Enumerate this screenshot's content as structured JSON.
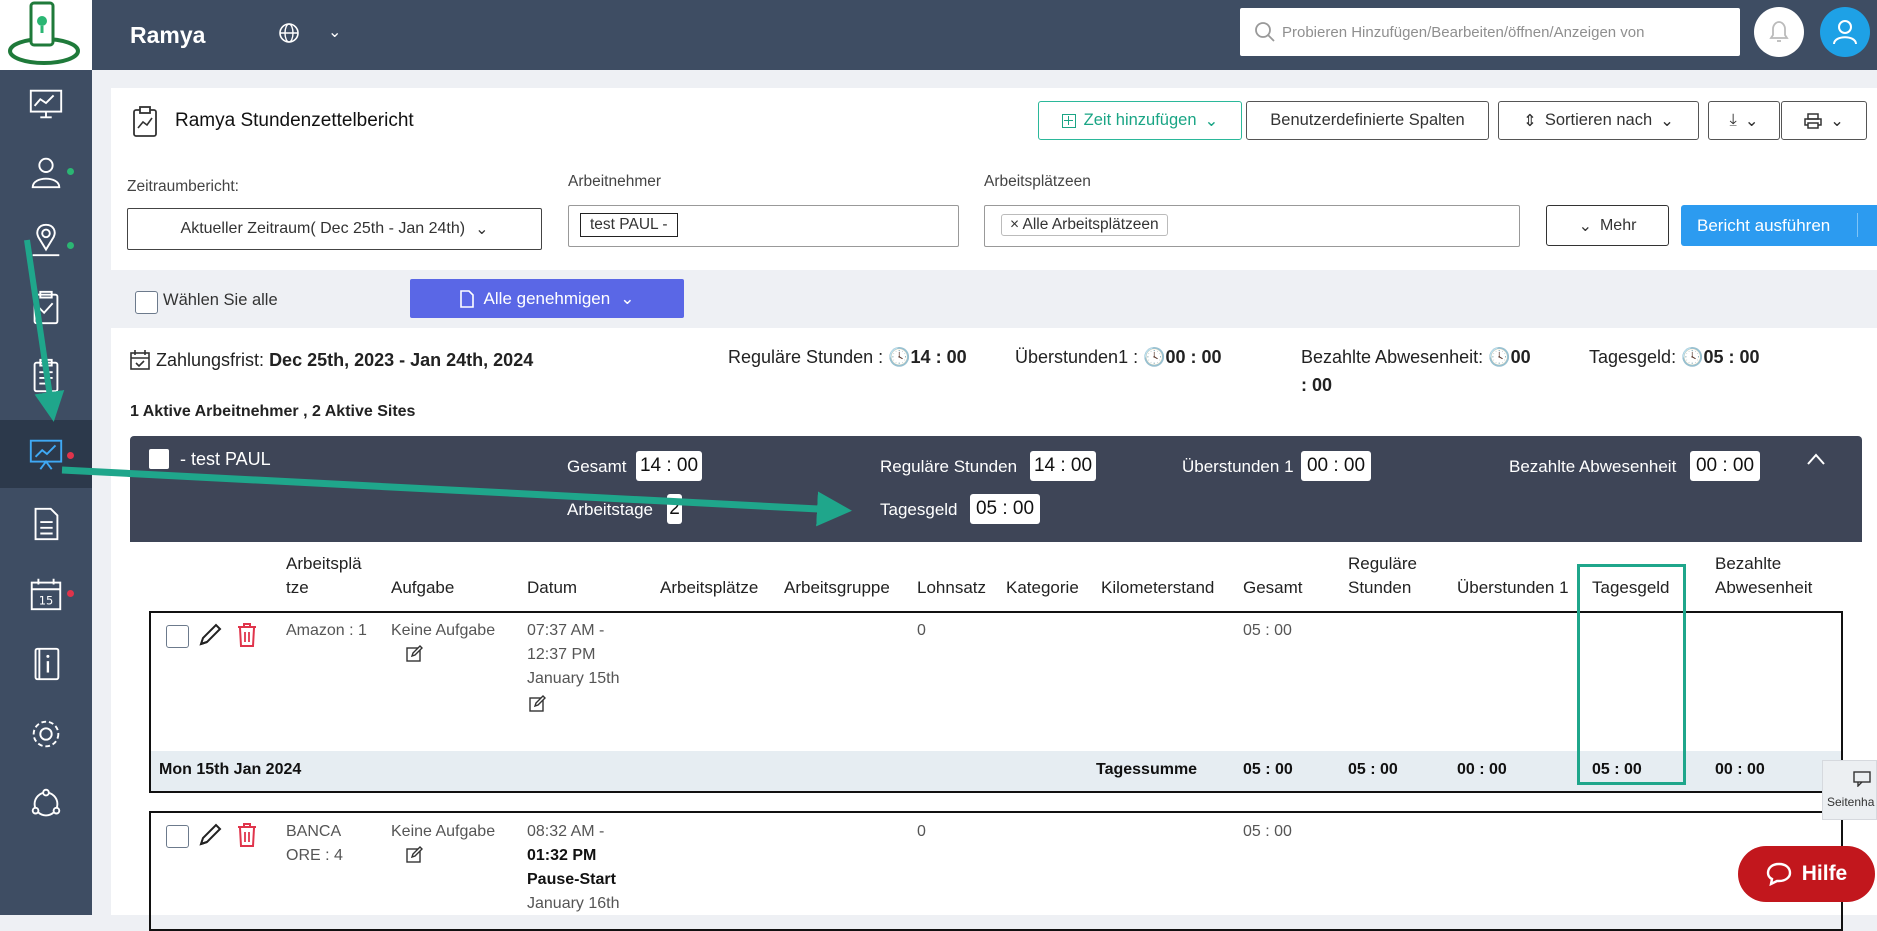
{
  "app": {
    "title": "Ramya"
  },
  "search": {
    "placeholder": "Probieren Hinzufügen/Bearbeiten/öffnen/Anzeigen von"
  },
  "header": {
    "title": "Ramya Stundenzettelbericht",
    "buttons": {
      "add_time": "Zeit hinzufügen",
      "custom_columns": "Benutzerdefinierte Spalten",
      "sort_by": "Sortieren nach"
    }
  },
  "filters": {
    "period_label": "Zeitraumbericht:",
    "period_value": "Aktueller Zeitraum( Dec 25th - Jan 24th)",
    "employee_label": "Arbeitnehmer",
    "employee_tag": "test PAUL -",
    "sites_label": "Arbeitsplätzeen",
    "sites_tag": "Alle Arbeitsplätzeen",
    "more": "Mehr",
    "run": "Bericht ausführen"
  },
  "actions": {
    "select_all": "Wählen Sie alle",
    "approve_all": "Alle genehmigen"
  },
  "summary": {
    "deadline_label": "Zahlungsfrist:",
    "deadline_value": "Dec 25th, 2023 - Jan 24th, 2024",
    "regular_label": "Reguläre Stunden :",
    "regular_value": "14 : 00",
    "overtime_label": "Überstunden1 :",
    "overtime_value": "00 : 00",
    "paid_absence_label": "Bezahlte Abwesenheit:",
    "paid_absence_value_1": "00",
    "paid_absence_value_2": ": 00",
    "per_diem_label": "Tagesgeld:",
    "per_diem_value": "05 : 00",
    "active": "1 Aktive Arbeitnehmer , 2 Aktive Sites"
  },
  "employee": {
    "name": "- test PAUL",
    "total_label": "Gesamt",
    "total_value": "14 : 00",
    "regular_label": "Reguläre Stunden",
    "regular_value": "14 : 00",
    "overtime_label": "Überstunden 1",
    "overtime_value": "00 : 00",
    "paid_absence_label": "Bezahlte Abwesenheit",
    "paid_absence_value": "00 : 00",
    "workdays_label": "Arbeitstage",
    "workdays_value": "2",
    "per_diem_label": "Tagesgeld",
    "per_diem_value": "05 : 00"
  },
  "columns": {
    "site_1": "Arbeitsplä",
    "site_2": "tze",
    "task": "Aufgabe",
    "date": "Datum",
    "sites": "Arbeitsplätze",
    "group": "Arbeitsgruppe",
    "wage": "Lohnsatz",
    "category": "Kategorie",
    "mileage": "Kilometerstand",
    "total": "Gesamt",
    "regular_1": "Reguläre",
    "regular_2": "Stunden",
    "overtime": "Überstunden 1",
    "per_diem": "Tagesgeld",
    "paid_1": "Bezahlte",
    "paid_2": "Abwesenheit"
  },
  "rows": [
    {
      "site": "Amazon : 1",
      "task": "Keine Aufgabe",
      "time_1": "07:37 AM -",
      "time_2": "12:37 PM",
      "date": "January 15th",
      "wage": "0",
      "total": "05 : 00"
    },
    {
      "site_1": "BANCA",
      "site_2": "ORE : 4",
      "task": "Keine Aufgabe",
      "time_1": "08:32 AM -",
      "time_2": "01:32 PM",
      "note": "Pause-Start",
      "date": "January 16th",
      "wage": "0",
      "total": "05 : 00"
    }
  ],
  "day_summary": {
    "date": "Mon 15th Jan 2024",
    "label": "Tagessumme",
    "total": "05 : 00",
    "regular": "05 : 00",
    "overtime": "00 : 00",
    "per_diem": "05 : 00",
    "paid_absence": "00 : 00"
  },
  "help": {
    "label": "Hilfe"
  },
  "side_tab": {
    "label": "Seitenha"
  },
  "colors": {
    "sidebar": "#3e4d63",
    "band": "#3e4557",
    "accent_blue": "#2c9bf0",
    "approve": "#5a67e6",
    "annotation": "#1fa68b",
    "help": "#c2171d"
  }
}
